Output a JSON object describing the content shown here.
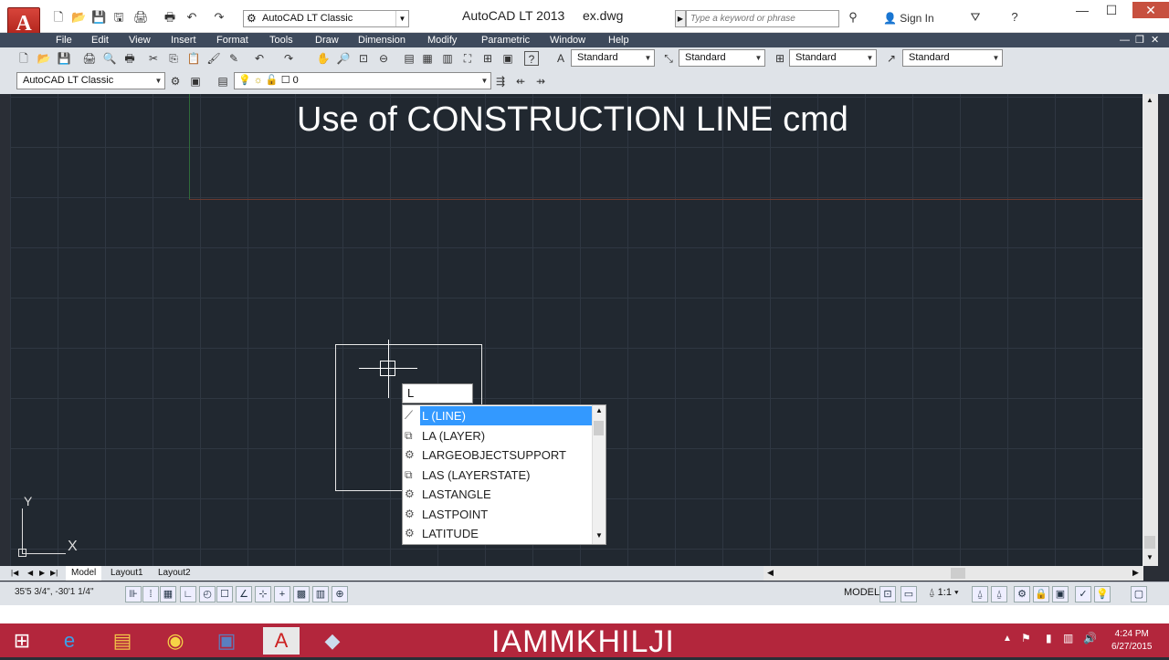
{
  "titlebar": {
    "app_name": "AutoCAD LT 2013",
    "file_name": "ex.dwg",
    "workspace": "AutoCAD LT Classic",
    "search_placeholder": "Type a keyword or phrase",
    "sign_in": "Sign In",
    "app_logo_letter": "A"
  },
  "menu": [
    "File",
    "Edit",
    "View",
    "Insert",
    "Format",
    "Tools",
    "Draw",
    "Dimension",
    "Modify",
    "Parametric",
    "Window",
    "Help"
  ],
  "styles_toolbar": {
    "text_style": "Standard",
    "dim_style": "Standard",
    "table_style": "Standard",
    "multileader_style": "Standard"
  },
  "layers_toolbar": {
    "workspace": "AutoCAD LT Classic",
    "current_layer": "0"
  },
  "drawing": {
    "title_text": "Use of CONSTRUCTION LINE cmd",
    "ucs_x": "X",
    "ucs_y": "Y"
  },
  "command": {
    "input_value": "L",
    "suggestions": [
      {
        "label": "L (LINE)",
        "icon": "line-icon",
        "selected": true
      },
      {
        "label": "LA (LAYER)",
        "icon": "layer-icon",
        "selected": false
      },
      {
        "label": "LARGEOBJECTSUPPORT",
        "icon": "settings-icon",
        "selected": false
      },
      {
        "label": "LAS (LAYERSTATE)",
        "icon": "layer-icon",
        "selected": false
      },
      {
        "label": "LASTANGLE",
        "icon": "settings-icon",
        "selected": false
      },
      {
        "label": "LASTPOINT",
        "icon": "settings-icon",
        "selected": false
      },
      {
        "label": "LATITUDE",
        "icon": "settings-icon",
        "selected": false
      }
    ]
  },
  "tabs": [
    "Model",
    "Layout1",
    "Layout2"
  ],
  "status": {
    "coordinates": "35'5 3/4\", -30'1 1/4\"",
    "space": "MODEL",
    "scale": "1:1"
  },
  "taskbar": {
    "watermark": "IAMMKHILJI",
    "time": "4:24 PM",
    "date": "6/27/2015"
  },
  "colors": {
    "canvas_bg": "#212830",
    "menu_bg": "#3e4a5c",
    "taskbar_bg": "#b3263c",
    "selection": "#3399ff"
  }
}
